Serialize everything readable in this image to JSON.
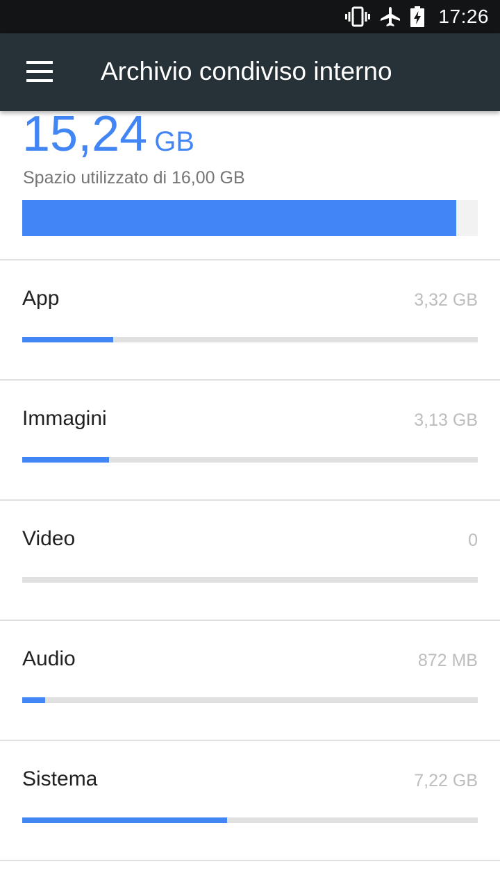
{
  "status_bar": {
    "time": "17:26",
    "icons": [
      "vibrate-icon",
      "airplane-icon",
      "battery-charging-icon"
    ]
  },
  "app_bar": {
    "title": "Archivio condiviso interno",
    "menu_icon": "menu-icon"
  },
  "storage": {
    "used_value": "15,24",
    "used_unit": "GB",
    "caption": "Spazio utilizzato di 16,00 GB",
    "used_fraction": 0.9525
  },
  "categories": [
    {
      "name": "App",
      "size": "3,32 GB",
      "fraction": 0.2
    },
    {
      "name": "Immagini",
      "size": "3,13 GB",
      "fraction": 0.19
    },
    {
      "name": "Video",
      "size": "0",
      "fraction": 0.0
    },
    {
      "name": "Audio",
      "size": "872 MB",
      "fraction": 0.05
    },
    {
      "name": "Sistema",
      "size": "7,22 GB",
      "fraction": 0.45
    }
  ],
  "colors": {
    "accent": "#4285f4",
    "app_bar": "#263238",
    "status_bar": "#121416"
  }
}
